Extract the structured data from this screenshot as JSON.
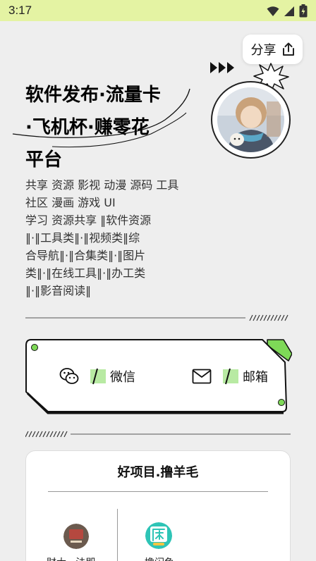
{
  "status_bar": {
    "time": "3:17"
  },
  "share": {
    "label": "分享"
  },
  "title": {
    "lines": [
      "软件发布·流量卡",
      "·飞机杯·赚零花",
      "平台"
    ]
  },
  "description": {
    "lines": [
      "共享 资源 影视 动漫 源码 工具",
      "社区 漫画 游戏 UI",
      "学习 资源共享 ‖软件资源",
      "‖·‖工具类‖·‖视频类‖综",
      "合导航‖·‖合集类‖·‖图片",
      "类‖·‖在线工具‖·‖办工类",
      "‖·‖影音阅读‖"
    ]
  },
  "contacts": {
    "wechat": "微信",
    "email": "邮箱"
  },
  "project": {
    "title": "好项目.撸羊毛",
    "items": [
      {
        "label": "财大...法即",
        "icon": "app-icon-1"
      },
      {
        "label": "撸闲鱼",
        "icon": "app-icon-2"
      }
    ]
  },
  "colors": {
    "status_bar": "#e4f3a3",
    "accent_green": "#7ed957",
    "background": "#eeeeee"
  }
}
